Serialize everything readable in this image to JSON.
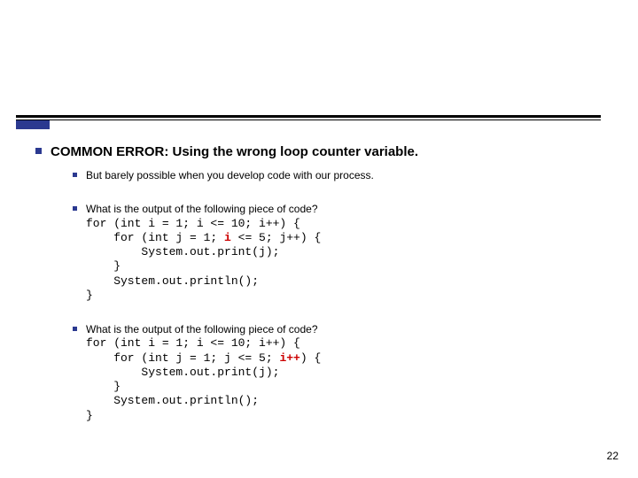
{
  "heading": "COMMON ERROR: Using the wrong loop counter variable.",
  "sub1": "But barely possible when you develop code with our process.",
  "q2": "What is the output of the following piece of code?",
  "c2_l1": "for (int i = 1; i <= 10; i++) {",
  "c2_l2": "    for (int j = 1; ",
  "c2_hlA": "i",
  "c2_l2b": " <= 5; j++) {",
  "c2_l3": "        System.out.print(j);",
  "c2_l4": "    }",
  "c2_l5": "    System.out.println();",
  "c2_l6": "}",
  "q3": "What is the output of the following piece of code?",
  "c3_l1": "for (int i = 1; i <= 10; i++) {",
  "c3_l2": "    for (int j = 1; j <= 5; ",
  "c3_hlA": "i++",
  "c3_l2b": ") {",
  "c3_l3": "        System.out.print(j);",
  "c3_l4": "    }",
  "c3_l5": "    System.out.println();",
  "c3_l6": "}",
  "page": "22"
}
